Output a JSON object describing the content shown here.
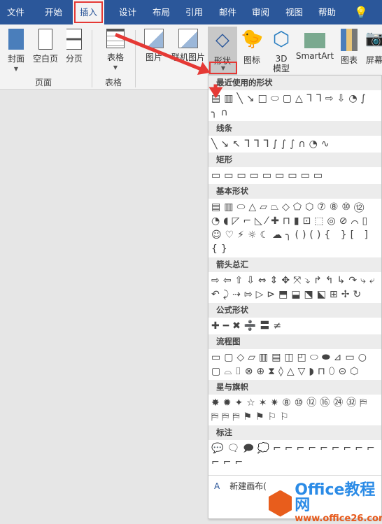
{
  "tabs": [
    "文件",
    "开始",
    "插入",
    "设计",
    "布局",
    "引用",
    "邮件",
    "审阅",
    "视图",
    "帮助"
  ],
  "active_tab": "插入",
  "ribbon": {
    "cover": "封面",
    "blank": "空白页",
    "pagebreak": "分页",
    "group_pages": "页面",
    "table": "表格",
    "group_table": "表格",
    "picture": "图片",
    "online_picture": "联机图片",
    "shapes": "形状",
    "icons": "图标",
    "model3d_1": "3D",
    "model3d_2": "模型",
    "smartart": "SmartArt",
    "chart": "图表",
    "screenshot": "屏幕"
  },
  "menu": {
    "sections": [
      {
        "title": "最近使用的形状",
        "shapes": "▤▥╲↘□⬭▢△ᒣᒣ⇨⇩◔∫╮∩"
      },
      {
        "title": "线条",
        "shapes": "╲↘↖ᒣᒣᒣ∫∫∫∩◔∿"
      },
      {
        "title": "矩形",
        "shapes": "▭▭▭▭▭▭▭▭▭"
      },
      {
        "title": "基本形状",
        "shapes": "▤▥⬭△▱⏢◇⬠⬡⑦⑧⑩⑫◔◖◸⌐◺⁄✚⊓▮⊡⬚◎⊘⌒▯☺♡⚡☼☾☁╮()(){ }[ ]{}"
      },
      {
        "title": "箭头总汇",
        "shapes": "⇨⇦⇧⇩⇔⇕✥⤧⤵↱↰↳↷⤷⤶↶⤸⇢⇰▷⊳⬒⬓⬔⬕⊞✢↻"
      },
      {
        "title": "公式形状",
        "shapes": "✚━✖➗〓≠"
      },
      {
        "title": "流程图",
        "shapes": "▭▢◇▱▥▤◫◰⬭⬬⊿▭○▢⌓⌷⊗⊕⧗◊△▽◗⊓⬯⊝⬡"
      },
      {
        "title": "星与旗帜",
        "shapes": "✸✹✦☆✶✷⑧⑩⑫⑯㉔㉜⛿⛿⛿⛿⚑⚑⚐⚐"
      },
      {
        "title": "标注",
        "shapes": "💬🗨🗩💭⌐⌐⌐⌐⌐⌐⌐⌐⌐⌐⌐⌐"
      }
    ],
    "new_canvas": "新建画布("
  },
  "watermark": {
    "t1": "Office教程网",
    "t2": "www.office26.com"
  }
}
